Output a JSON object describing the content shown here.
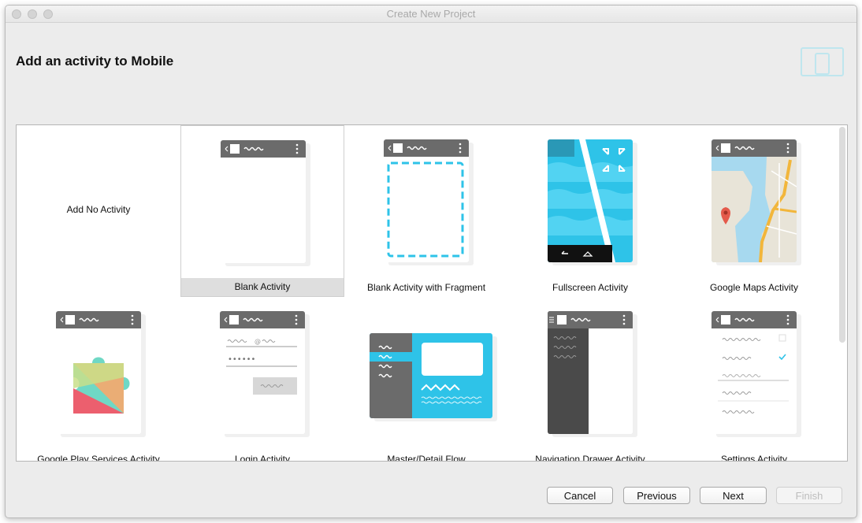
{
  "window": {
    "title": "Create New Project"
  },
  "heading": "Add an activity to Mobile",
  "activities": [
    {
      "label": "Add No Activity",
      "icon": "no-activity",
      "selected": false
    },
    {
      "label": "Blank Activity",
      "icon": "blank-activity-icon",
      "selected": true
    },
    {
      "label": "Blank Activity with Fragment",
      "icon": "blank-fragment-icon",
      "selected": false
    },
    {
      "label": "Fullscreen Activity",
      "icon": "fullscreen-icon",
      "selected": false
    },
    {
      "label": "Google Maps Activity",
      "icon": "map-icon",
      "selected": false
    },
    {
      "label": "Google Play Services Activity",
      "icon": "play-services-icon",
      "selected": false
    },
    {
      "label": "Login Activity",
      "icon": "login-icon",
      "selected": false
    },
    {
      "label": "Master/Detail Flow",
      "icon": "master-detail-icon",
      "selected": false
    },
    {
      "label": "Navigation Drawer Activity",
      "icon": "navigation-drawer-icon",
      "selected": false
    },
    {
      "label": "Settings Activity",
      "icon": "settings-icon",
      "selected": false
    }
  ],
  "buttons": {
    "cancel": "Cancel",
    "previous": "Previous",
    "next": "Next",
    "finish": "Finish"
  },
  "colors": {
    "accent": "#2ec3e8",
    "phone_bar": "#6b6b6b",
    "selection": "#dedede"
  }
}
